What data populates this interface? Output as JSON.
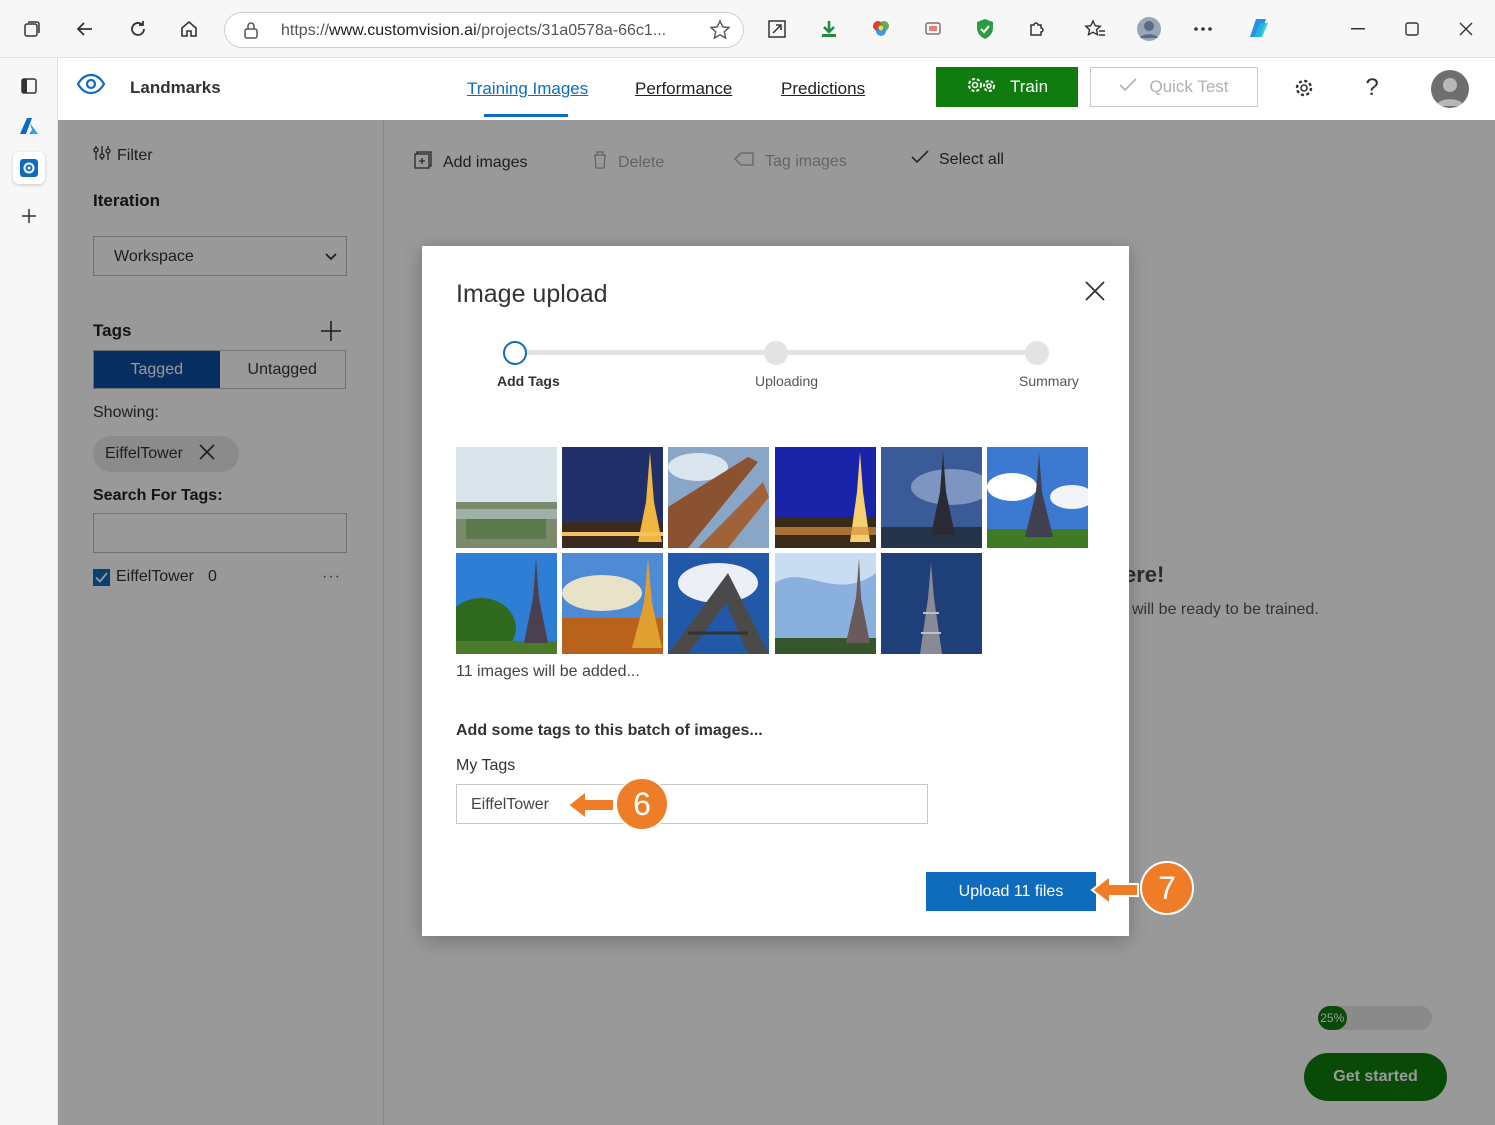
{
  "browser": {
    "url_prefix": "https://",
    "url_host": "www.customvision.ai",
    "url_path": "/projects/31a0578a-66c1..."
  },
  "app": {
    "project_name": "Landmarks",
    "nav": [
      "Training Images",
      "Performance",
      "Predictions"
    ],
    "train_label": "Train",
    "quick_test_label": "Quick Test",
    "help_label": "?"
  },
  "left": {
    "filter_label": "Filter",
    "iteration_heading": "Iteration",
    "iteration_value": "Workspace",
    "tags_heading": "Tags",
    "tagged_label": "Tagged",
    "untagged_label": "Untagged",
    "showing_label": "Showing:",
    "showing_pill": "EiffelTower",
    "search_heading": "Search For Tags:",
    "tag_item_name": "EiffelTower",
    "tag_item_count": "0",
    "more_label": "···"
  },
  "toolbar": {
    "add_images": "Add images",
    "delete": "Delete",
    "tag_images": "Tag images",
    "select_all": "Select all"
  },
  "background": {
    "headline_fragment": "ere!",
    "sub_fragment": "will be ready to be trained.",
    "progress_label": "25%",
    "progress_value": 0.25,
    "get_started": "Get started"
  },
  "modal": {
    "title": "Image upload",
    "steps": [
      "Add Tags",
      "Uploading",
      "Summary"
    ],
    "active_step": 0,
    "image_count_text": "11 images will be added...",
    "add_tags_heading": "Add some tags to this batch of images...",
    "my_tags_label": "My Tags",
    "my_tags_value": "EiffelTower",
    "upload_label": "Upload 11 files"
  },
  "callouts": [
    "6",
    "7"
  ],
  "colors": {
    "accent_blue": "#0f6cbd",
    "train_green": "#107c10",
    "callout_orange": "#ef7d27"
  }
}
